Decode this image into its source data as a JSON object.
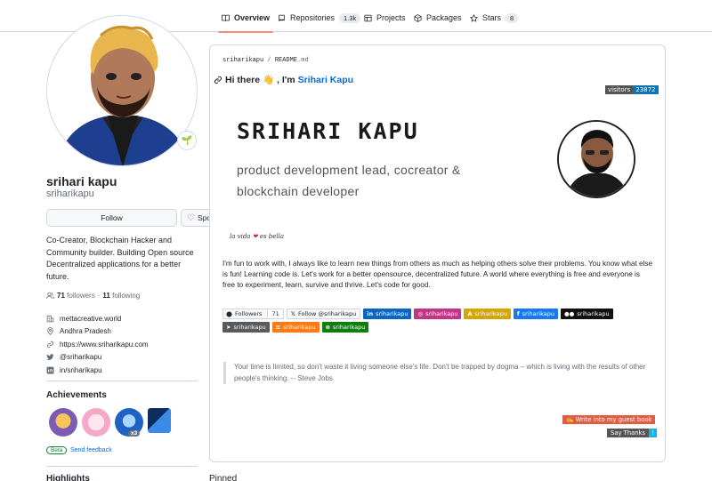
{
  "nav": {
    "tabs": [
      {
        "label": "Overview",
        "icon": "book-icon",
        "count": null
      },
      {
        "label": "Repositories",
        "icon": "repo-icon",
        "count": "1.3k"
      },
      {
        "label": "Projects",
        "icon": "table-icon",
        "count": null
      },
      {
        "label": "Packages",
        "icon": "package-icon",
        "count": null
      },
      {
        "label": "Stars",
        "icon": "star-icon",
        "count": "8"
      }
    ]
  },
  "profile": {
    "name": "srihari kapu",
    "login": "sriharikapu",
    "follow_label": "Follow",
    "sponsor_label": "Sponsor",
    "bio": "Co-Creator, Blockchain Hacker and Community builder. Building Open source Decentralized applications for a better future.",
    "followers_count": "71",
    "followers_label": "followers",
    "separator": "·",
    "following_count": "11",
    "following_label": "following",
    "details": [
      {
        "icon": "organization-icon",
        "text": "mettacreative.world"
      },
      {
        "icon": "location-icon",
        "text": "Andhra Pradesh"
      },
      {
        "icon": "link-icon",
        "text": "https://www.sriharikapu.com"
      },
      {
        "icon": "twitter-icon",
        "text": "@sriharikapu"
      },
      {
        "icon": "linkedin-icon",
        "text": "in/sriharikapu"
      }
    ],
    "achievements_title": "Achievements",
    "achievement_multiplier": "x3",
    "beta_label": "Beta",
    "feedback_label": "Send feedback",
    "highlights_title": "Highlights"
  },
  "readme": {
    "path_user": "sriharikapu",
    "path_sep": "/",
    "path_file": "README",
    "path_ext": ".md",
    "greeting": "Hi there 👋 , I'm",
    "greeting_name": "Srihari Kapu",
    "visitors_label": "visitors",
    "visitors_count": "23872",
    "banner_name": "SRIHARI KAPU",
    "banner_role_line1": "product development lead, cocreator &",
    "banner_role_line2": "blockchain developer",
    "banner_script_a": "la vida",
    "banner_script_heart": "❤",
    "banner_script_b": "es bella",
    "paragraph": "I'm fun to work with, I always like to learn new things from others as much as helping others solve their problems. You know what else is fun! Learning code is. Let's work for a better opensource, decentralized future. A world where everything is free and everyone is free to experiment, learn, survive and thrive. Let's code for good.",
    "shields": [
      {
        "label": "Followers",
        "count": "71",
        "style": "gh"
      },
      {
        "label": "Follow @sriharikapu",
        "style": "x"
      },
      {
        "label": "sriharikapu",
        "style": "linkedin",
        "color": "#0a66c2"
      },
      {
        "label": "sriharikapu",
        "style": "instagram",
        "color": "#c13584"
      },
      {
        "label": "sriharikapu",
        "style": "angel",
        "color": "#d6a600"
      },
      {
        "label": "sriharikapu",
        "style": "facebook",
        "color": "#1877f2"
      },
      {
        "label": "sriharikapu",
        "style": "medium",
        "color": "#12100e"
      },
      {
        "label": "sriharikapu",
        "style": "telegram",
        "color": "#5a5a5a"
      },
      {
        "label": "sriharikapu",
        "style": "stackoverflow",
        "color": "#fe7a16"
      },
      {
        "label": "sriharikapu",
        "style": "xbox",
        "color": "#107c10"
      }
    ],
    "quote": "Your time is limited, so don't waste it living someone else's life. Don't be trapped by dogma – which is living with the results of other people's thinking. -- Steve Jobs",
    "guestbook_label": "✍️ Write into my guest book",
    "thanks_label": "Say Thanks",
    "thanks_mark": "!"
  },
  "pinned_title": "Pinned",
  "colors": {
    "accent": "#fd8c73",
    "link": "#0969da",
    "border": "#d0d7de"
  }
}
